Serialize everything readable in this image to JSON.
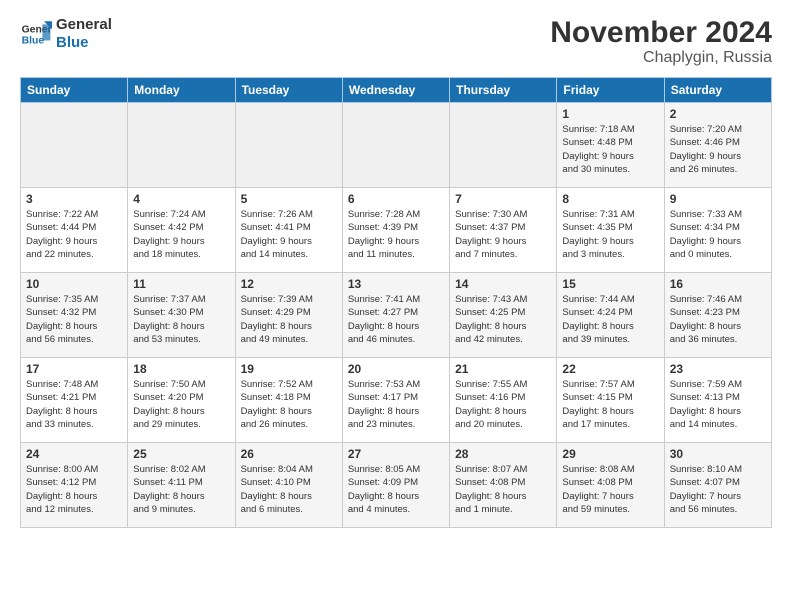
{
  "header": {
    "logo_line1": "General",
    "logo_line2": "Blue",
    "title": "November 2024",
    "subtitle": "Chaplygin, Russia"
  },
  "weekdays": [
    "Sunday",
    "Monday",
    "Tuesday",
    "Wednesday",
    "Thursday",
    "Friday",
    "Saturday"
  ],
  "weeks": [
    [
      {
        "day": "",
        "info": ""
      },
      {
        "day": "",
        "info": ""
      },
      {
        "day": "",
        "info": ""
      },
      {
        "day": "",
        "info": ""
      },
      {
        "day": "",
        "info": ""
      },
      {
        "day": "1",
        "info": "Sunrise: 7:18 AM\nSunset: 4:48 PM\nDaylight: 9 hours\nand 30 minutes."
      },
      {
        "day": "2",
        "info": "Sunrise: 7:20 AM\nSunset: 4:46 PM\nDaylight: 9 hours\nand 26 minutes."
      }
    ],
    [
      {
        "day": "3",
        "info": "Sunrise: 7:22 AM\nSunset: 4:44 PM\nDaylight: 9 hours\nand 22 minutes."
      },
      {
        "day": "4",
        "info": "Sunrise: 7:24 AM\nSunset: 4:42 PM\nDaylight: 9 hours\nand 18 minutes."
      },
      {
        "day": "5",
        "info": "Sunrise: 7:26 AM\nSunset: 4:41 PM\nDaylight: 9 hours\nand 14 minutes."
      },
      {
        "day": "6",
        "info": "Sunrise: 7:28 AM\nSunset: 4:39 PM\nDaylight: 9 hours\nand 11 minutes."
      },
      {
        "day": "7",
        "info": "Sunrise: 7:30 AM\nSunset: 4:37 PM\nDaylight: 9 hours\nand 7 minutes."
      },
      {
        "day": "8",
        "info": "Sunrise: 7:31 AM\nSunset: 4:35 PM\nDaylight: 9 hours\nand 3 minutes."
      },
      {
        "day": "9",
        "info": "Sunrise: 7:33 AM\nSunset: 4:34 PM\nDaylight: 9 hours\nand 0 minutes."
      }
    ],
    [
      {
        "day": "10",
        "info": "Sunrise: 7:35 AM\nSunset: 4:32 PM\nDaylight: 8 hours\nand 56 minutes."
      },
      {
        "day": "11",
        "info": "Sunrise: 7:37 AM\nSunset: 4:30 PM\nDaylight: 8 hours\nand 53 minutes."
      },
      {
        "day": "12",
        "info": "Sunrise: 7:39 AM\nSunset: 4:29 PM\nDaylight: 8 hours\nand 49 minutes."
      },
      {
        "day": "13",
        "info": "Sunrise: 7:41 AM\nSunset: 4:27 PM\nDaylight: 8 hours\nand 46 minutes."
      },
      {
        "day": "14",
        "info": "Sunrise: 7:43 AM\nSunset: 4:25 PM\nDaylight: 8 hours\nand 42 minutes."
      },
      {
        "day": "15",
        "info": "Sunrise: 7:44 AM\nSunset: 4:24 PM\nDaylight: 8 hours\nand 39 minutes."
      },
      {
        "day": "16",
        "info": "Sunrise: 7:46 AM\nSunset: 4:23 PM\nDaylight: 8 hours\nand 36 minutes."
      }
    ],
    [
      {
        "day": "17",
        "info": "Sunrise: 7:48 AM\nSunset: 4:21 PM\nDaylight: 8 hours\nand 33 minutes."
      },
      {
        "day": "18",
        "info": "Sunrise: 7:50 AM\nSunset: 4:20 PM\nDaylight: 8 hours\nand 29 minutes."
      },
      {
        "day": "19",
        "info": "Sunrise: 7:52 AM\nSunset: 4:18 PM\nDaylight: 8 hours\nand 26 minutes."
      },
      {
        "day": "20",
        "info": "Sunrise: 7:53 AM\nSunset: 4:17 PM\nDaylight: 8 hours\nand 23 minutes."
      },
      {
        "day": "21",
        "info": "Sunrise: 7:55 AM\nSunset: 4:16 PM\nDaylight: 8 hours\nand 20 minutes."
      },
      {
        "day": "22",
        "info": "Sunrise: 7:57 AM\nSunset: 4:15 PM\nDaylight: 8 hours\nand 17 minutes."
      },
      {
        "day": "23",
        "info": "Sunrise: 7:59 AM\nSunset: 4:13 PM\nDaylight: 8 hours\nand 14 minutes."
      }
    ],
    [
      {
        "day": "24",
        "info": "Sunrise: 8:00 AM\nSunset: 4:12 PM\nDaylight: 8 hours\nand 12 minutes."
      },
      {
        "day": "25",
        "info": "Sunrise: 8:02 AM\nSunset: 4:11 PM\nDaylight: 8 hours\nand 9 minutes."
      },
      {
        "day": "26",
        "info": "Sunrise: 8:04 AM\nSunset: 4:10 PM\nDaylight: 8 hours\nand 6 minutes."
      },
      {
        "day": "27",
        "info": "Sunrise: 8:05 AM\nSunset: 4:09 PM\nDaylight: 8 hours\nand 4 minutes."
      },
      {
        "day": "28",
        "info": "Sunrise: 8:07 AM\nSunset: 4:08 PM\nDaylight: 8 hours\nand 1 minute."
      },
      {
        "day": "29",
        "info": "Sunrise: 8:08 AM\nSunset: 4:08 PM\nDaylight: 7 hours\nand 59 minutes."
      },
      {
        "day": "30",
        "info": "Sunrise: 8:10 AM\nSunset: 4:07 PM\nDaylight: 7 hours\nand 56 minutes."
      }
    ]
  ]
}
